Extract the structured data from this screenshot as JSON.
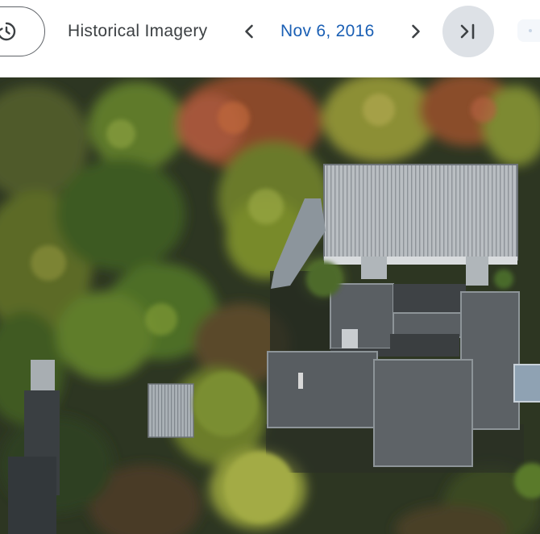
{
  "toolbar": {
    "history_label": "Historical Imagery",
    "date": "Nov 6, 2016"
  },
  "icons": {
    "history": "history-icon",
    "previous": "chevron-left-icon",
    "next": "chevron-right-icon",
    "latest": "skip-to-latest-icon"
  },
  "colors": {
    "date_text": "#1a5fb4",
    "label_text": "#3c4043",
    "latest_button_bg": "#dde1e6"
  }
}
